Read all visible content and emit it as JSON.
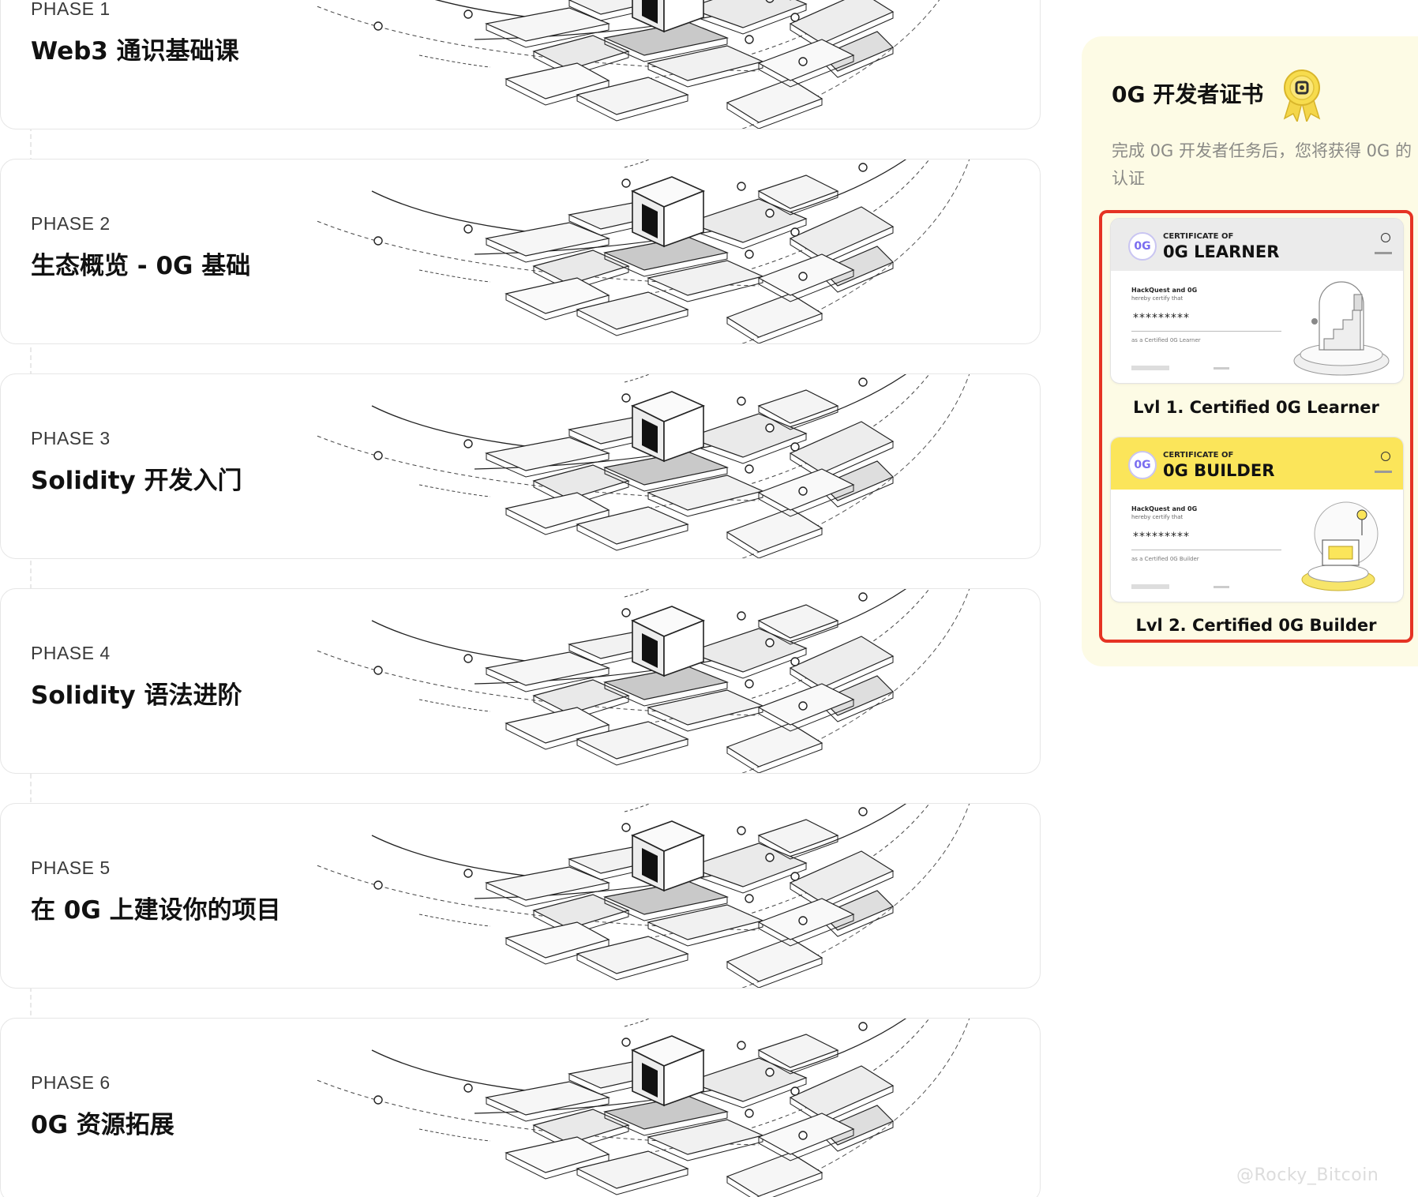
{
  "phases": [
    {
      "label": "PHASE 1",
      "title": "Web3 通识基础课"
    },
    {
      "label": "PHASE 2",
      "title": "生态概览 - 0G 基础"
    },
    {
      "label": "PHASE 3",
      "title": "Solidity 开发入门"
    },
    {
      "label": "PHASE 4",
      "title": "Solidity 语法进阶"
    },
    {
      "label": "PHASE 5",
      "title": "在 0G 上建设你的项目"
    },
    {
      "label": "PHASE 6",
      "title": "0G 资源拓展"
    }
  ],
  "certificate": {
    "heading": "0G 开发者证书",
    "description": "完成 0G 开发者任务后，您将获得 0G 的认证",
    "medal_icon": "medal-icon",
    "highlight_color": "#e53323",
    "panel_color": "#fdfbe5",
    "cards": [
      {
        "badge": "0G",
        "cert_of": "CERTIFICATE OF",
        "type": "0G LEARNER",
        "issuer": "HackQuest and 0G",
        "hereby": "hereby certify that",
        "name": "*********",
        "as_text": "as a Certified 0G Learner",
        "caption": "Lvl 1. Certified 0G Learner",
        "header_color": "#ebebeb"
      },
      {
        "badge": "0G",
        "cert_of": "CERTIFICATE OF",
        "type": "0G BUILDER",
        "issuer": "HackQuest and 0G",
        "hereby": "hereby certify that",
        "name": "*********",
        "as_text": "as a Certified 0G Builder",
        "caption": "Lvl 2. Certified 0G Builder",
        "header_color": "#fbe55a"
      }
    ]
  },
  "watermark": "@Rocky_Bitcoin"
}
